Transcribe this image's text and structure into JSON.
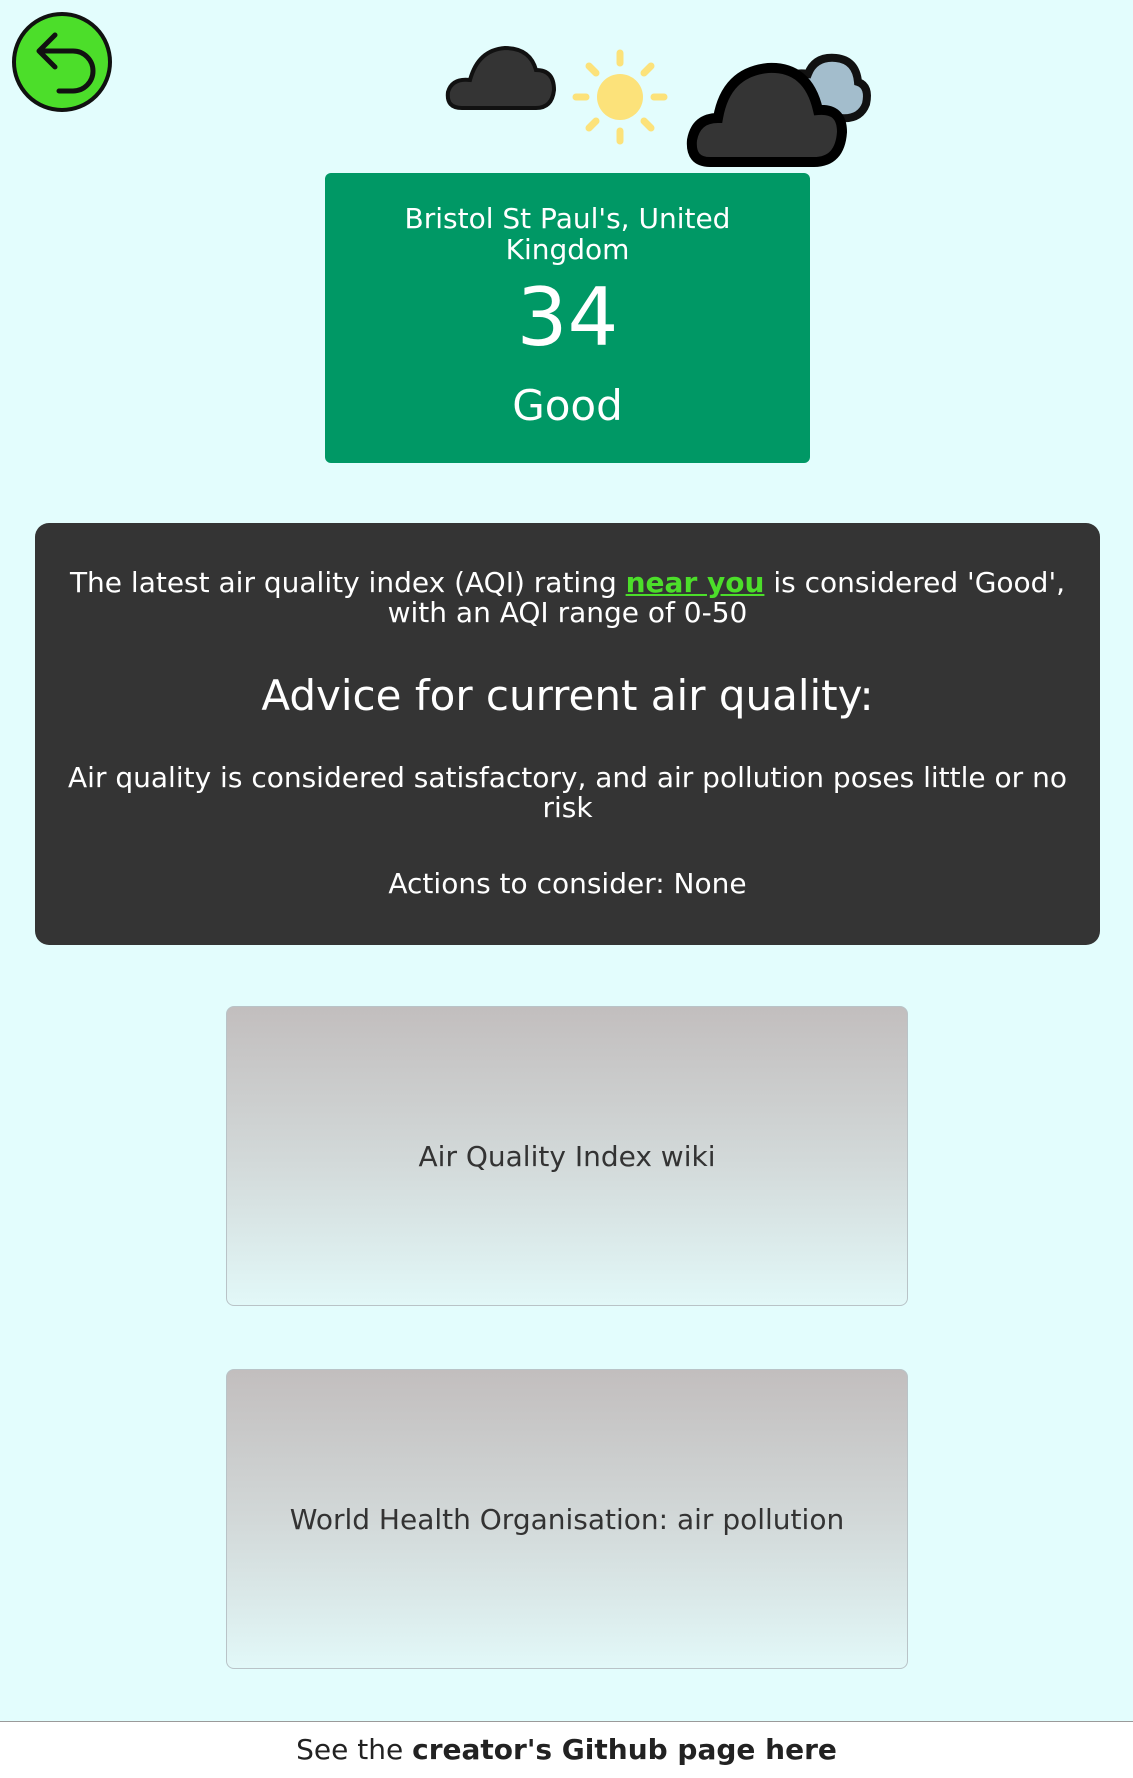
{
  "aqi_card": {
    "location": "Bristol St Paul's, United Kingdom",
    "value": "34",
    "category": "Good",
    "color": "#009865"
  },
  "advice": {
    "summary_before": "The latest air quality index (AQI) rating ",
    "near_you_link": "near you",
    "summary_after": " is considered 'Good', with an AQI range of 0-50",
    "heading": "Advice for current air quality:",
    "text": "Air quality is considered satisfactory, and air pollution poses little or no risk",
    "actions": "Actions to consider: None"
  },
  "links": {
    "wiki": "Air Quality Index wiki",
    "who": "World Health Organisation: air pollution"
  },
  "footer": {
    "prefix": "See the ",
    "link": "creator's Github page here"
  },
  "icons": {
    "back": "back-arrow-icon",
    "weather": [
      "cloud-icon",
      "sun-icon",
      "cloud-with-cloud-icon"
    ]
  },
  "colors": {
    "background": "#e3fdfd",
    "back_button": "#4cde2a",
    "panel": "#343434",
    "link_green": "#4cde2a"
  }
}
